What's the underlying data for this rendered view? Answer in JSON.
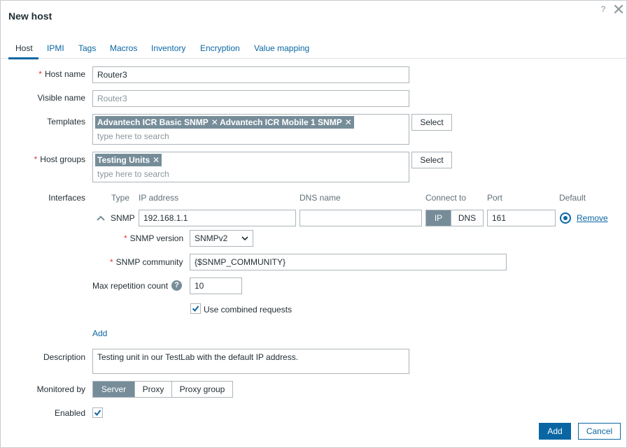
{
  "dialog": {
    "title": "New host",
    "help": "?"
  },
  "tabs": [
    "Host",
    "IPMI",
    "Tags",
    "Macros",
    "Inventory",
    "Encryption",
    "Value mapping"
  ],
  "host_name": {
    "label": "Host name",
    "required": "*",
    "value": "Router3"
  },
  "visible_name": {
    "label": "Visible name",
    "placeholder": "Router3"
  },
  "templates": {
    "label": "Templates",
    "chips": [
      "Advantech ICR Basic SNMP",
      "Advantech ICR Mobile 1 SNMP"
    ],
    "remove_glyph": "✕",
    "placeholder": "type here to search",
    "select_label": "Select"
  },
  "host_groups": {
    "label": "Host groups",
    "required": "*",
    "chips": [
      "Testing Units"
    ],
    "placeholder": "type here to search",
    "select_label": "Select"
  },
  "interfaces": {
    "label": "Interfaces",
    "columns": {
      "type": "Type",
      "ip": "IP address",
      "dns": "DNS name",
      "connect": "Connect to",
      "port": "Port",
      "default": "Default"
    },
    "row": {
      "type": "SNMP",
      "ip": "192.168.1.1",
      "dns": "",
      "connect_options": [
        "IP",
        "DNS"
      ],
      "connect_selected": "IP",
      "port": "161",
      "remove_label": "Remove"
    },
    "snmp_version": {
      "label": "SNMP version",
      "required": "*",
      "value": "SNMPv2"
    },
    "snmp_community": {
      "label": "SNMP community",
      "required": "*",
      "value": "{$SNMP_COMMUNITY}"
    },
    "max_repetition": {
      "label": "Max repetition count",
      "help": "?",
      "value": "10"
    },
    "combined_requests": {
      "label": "Use combined requests",
      "checked": true
    },
    "add_label": "Add"
  },
  "description": {
    "label": "Description",
    "value": "Testing unit in our TestLab with the default IP address."
  },
  "monitored_by": {
    "label": "Monitored by",
    "options": [
      "Server",
      "Proxy",
      "Proxy group"
    ],
    "selected": "Server"
  },
  "enabled": {
    "label": "Enabled",
    "checked": true
  },
  "footer": {
    "add_label": "Add",
    "cancel_label": "Cancel"
  },
  "colors": {
    "accent": "#0a66a3",
    "chip": "#768d99",
    "required": "#e33734",
    "border": "#acb5ba"
  }
}
